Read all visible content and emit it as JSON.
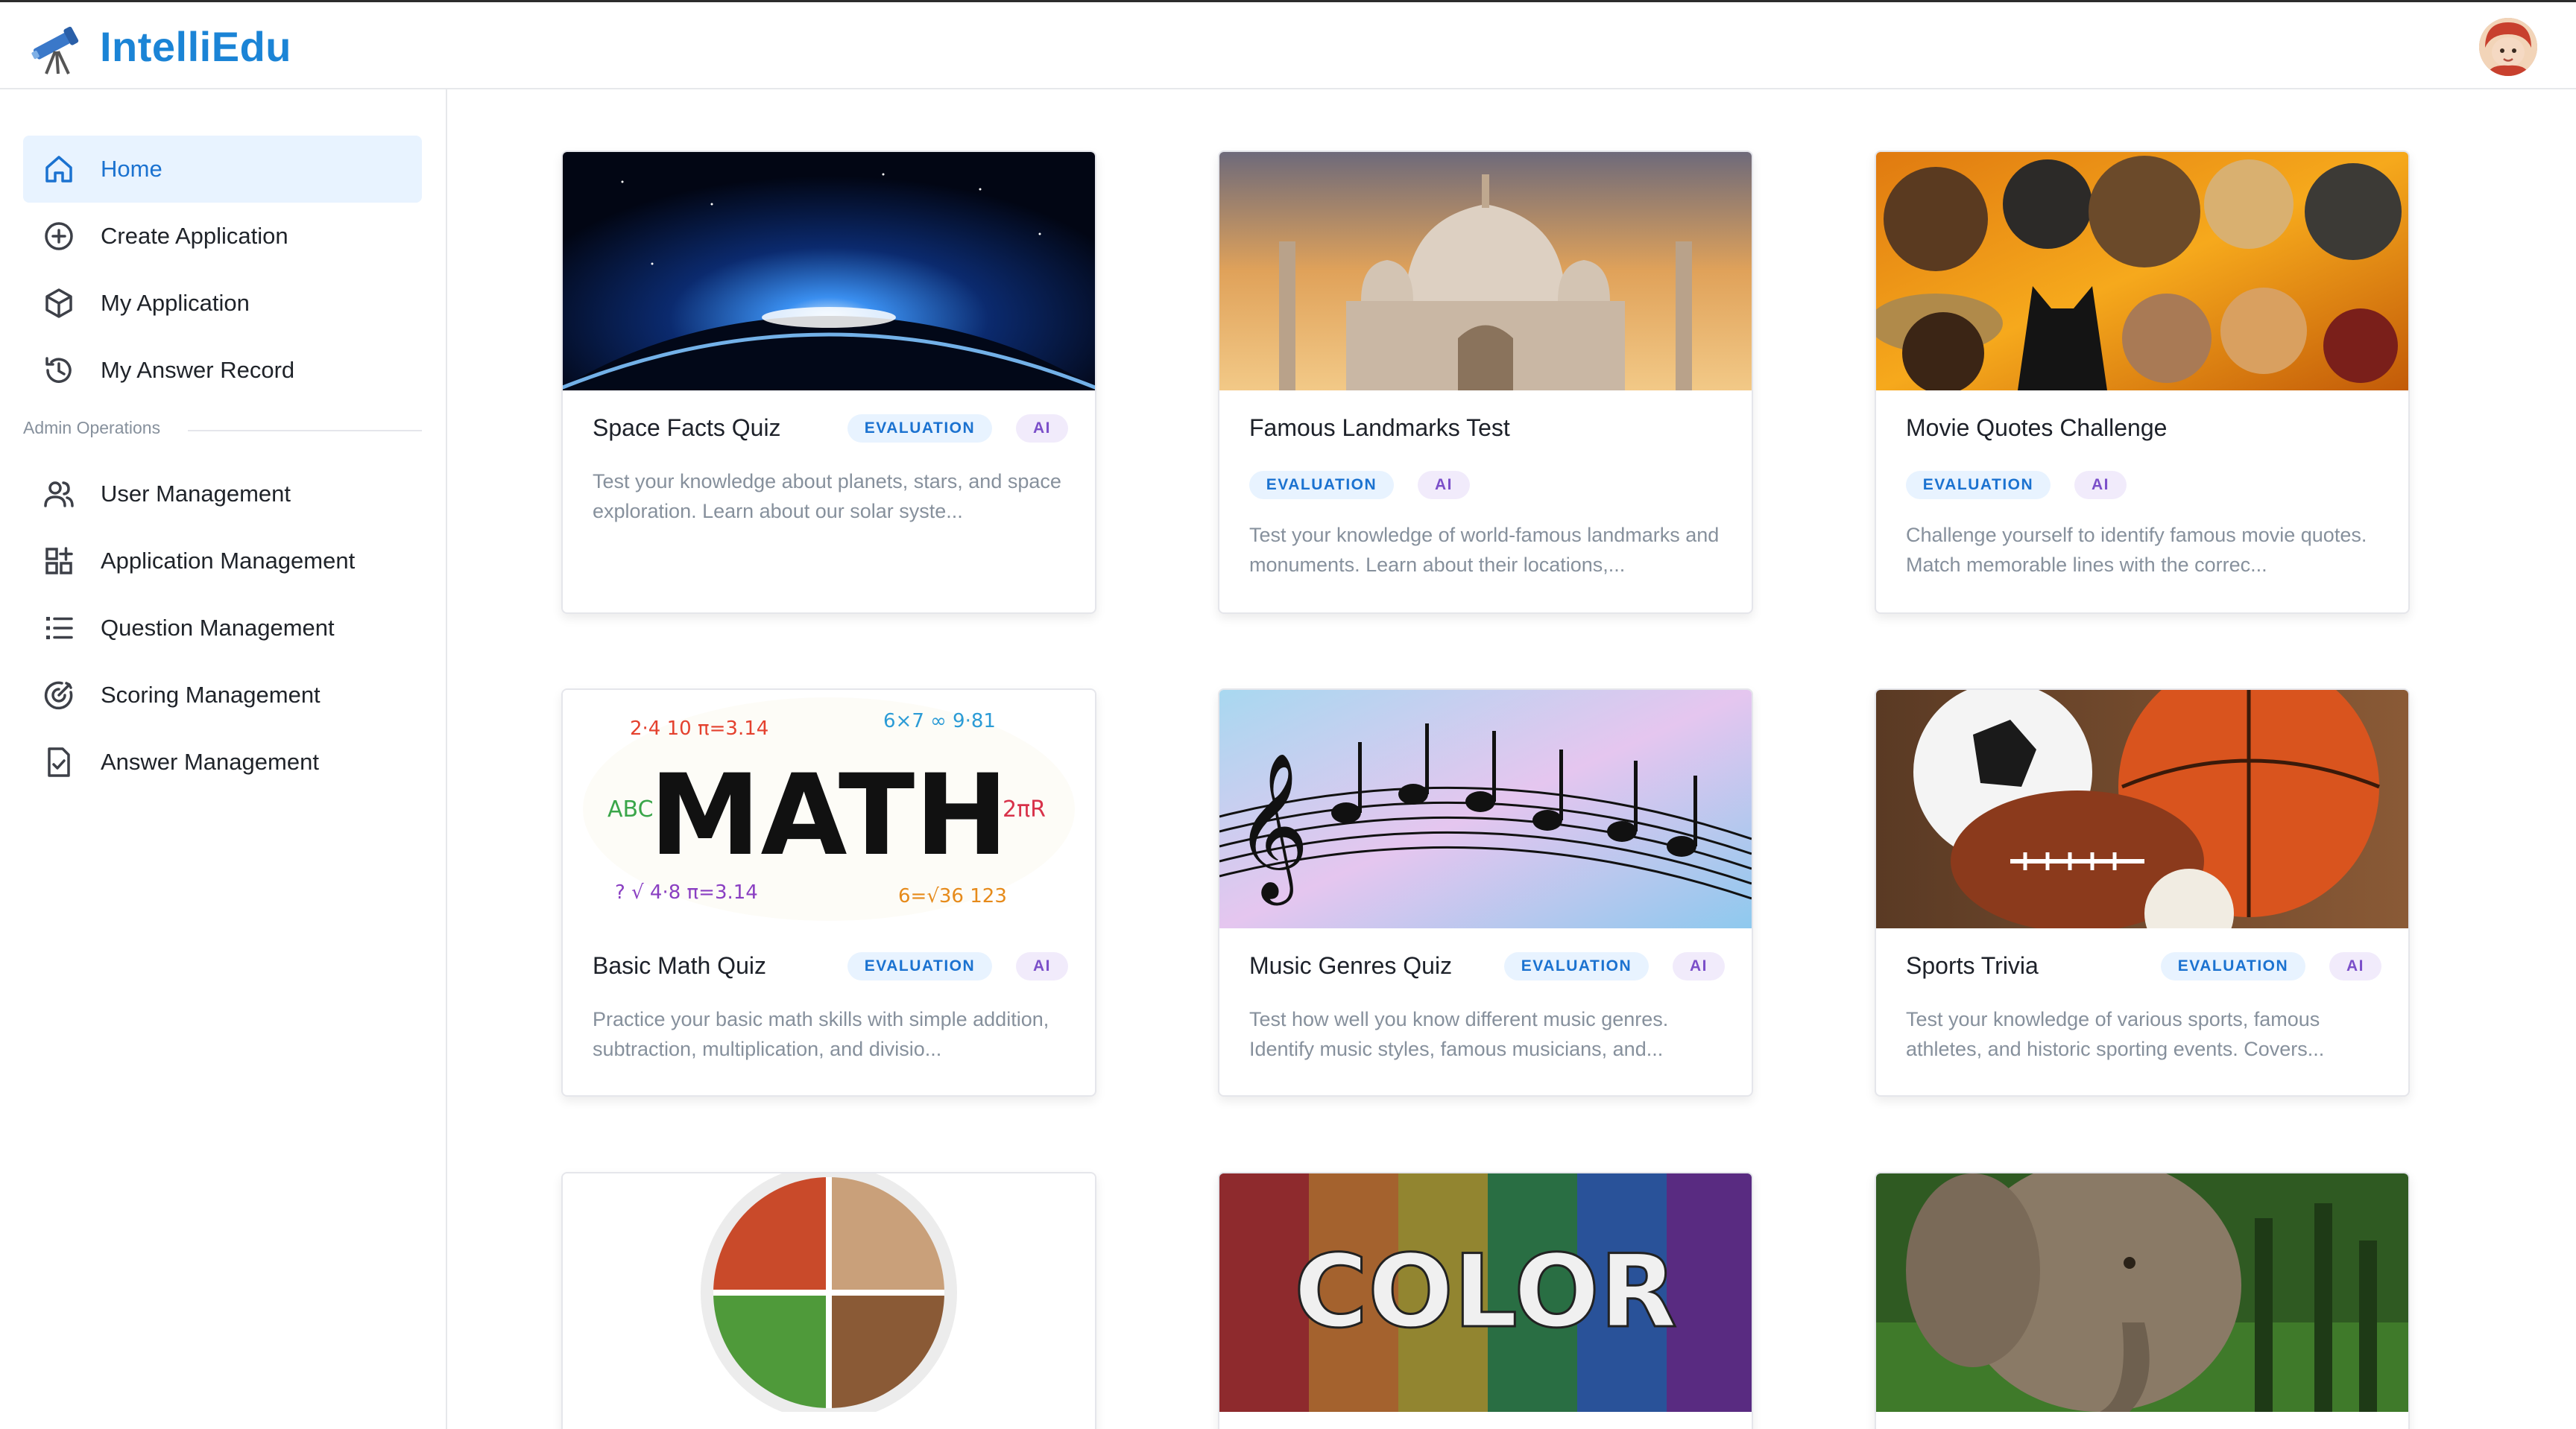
{
  "app": {
    "name": "IntelliEdu"
  },
  "sidebar": {
    "items": [
      {
        "label": "Home",
        "icon": "home-icon",
        "active": true
      },
      {
        "label": "Create Application",
        "icon": "plus-circle-icon",
        "active": false
      },
      {
        "label": "My Application",
        "icon": "cube-icon",
        "active": false
      },
      {
        "label": "My Answer Record",
        "icon": "history-icon",
        "active": false
      }
    ],
    "admin_title": "Admin Operations",
    "admin_items": [
      {
        "label": "User Management",
        "icon": "users-icon"
      },
      {
        "label": "Application Management",
        "icon": "apps-icon"
      },
      {
        "label": "Question Management",
        "icon": "list-icon"
      },
      {
        "label": "Scoring Management",
        "icon": "target-icon"
      },
      {
        "label": "Answer Management",
        "icon": "file-check-icon"
      }
    ]
  },
  "colors": {
    "brand": "#1b84d6",
    "active_bg": "#e8f3ff",
    "evaluation_tag": "#1b72d0",
    "ai_tag": "#7b4fc9"
  },
  "cards": [
    {
      "title": "Space Facts Quiz",
      "tags": [
        "EVALUATION",
        "AI"
      ],
      "desc": "Test your knowledge about planets, stars, and space exploration. Learn about our solar syste..."
    },
    {
      "title": "Famous Landmarks Test",
      "tags": [
        "EVALUATION",
        "AI"
      ],
      "desc": "Test your knowledge of world-famous landmarks and monuments. Learn about their locations,..."
    },
    {
      "title": "Movie Quotes Challenge",
      "tags": [
        "EVALUATION",
        "AI"
      ],
      "desc": "Challenge yourself to identify famous movie quotes. Match memorable lines with the correc..."
    },
    {
      "title": "Basic Math Quiz",
      "tags": [
        "EVALUATION",
        "AI"
      ],
      "desc": "Practice your basic math skills with simple addition, subtraction, multiplication, and divisio...",
      "image_text": "MATH"
    },
    {
      "title": "Music Genres Quiz",
      "tags": [
        "EVALUATION",
        "AI"
      ],
      "desc": "Test how well you know different music genres. Identify music styles, famous musicians, and..."
    },
    {
      "title": "Sports Trivia",
      "tags": [
        "EVALUATION",
        "AI"
      ],
      "desc": "Test your knowledge of various sports, famous athletes, and historic sporting events. Covers..."
    },
    {
      "title": "",
      "tags": [],
      "desc": ""
    },
    {
      "title": "",
      "tags": [],
      "desc": "",
      "image_text": "COLOR"
    },
    {
      "title": "",
      "tags": [],
      "desc": ""
    }
  ]
}
